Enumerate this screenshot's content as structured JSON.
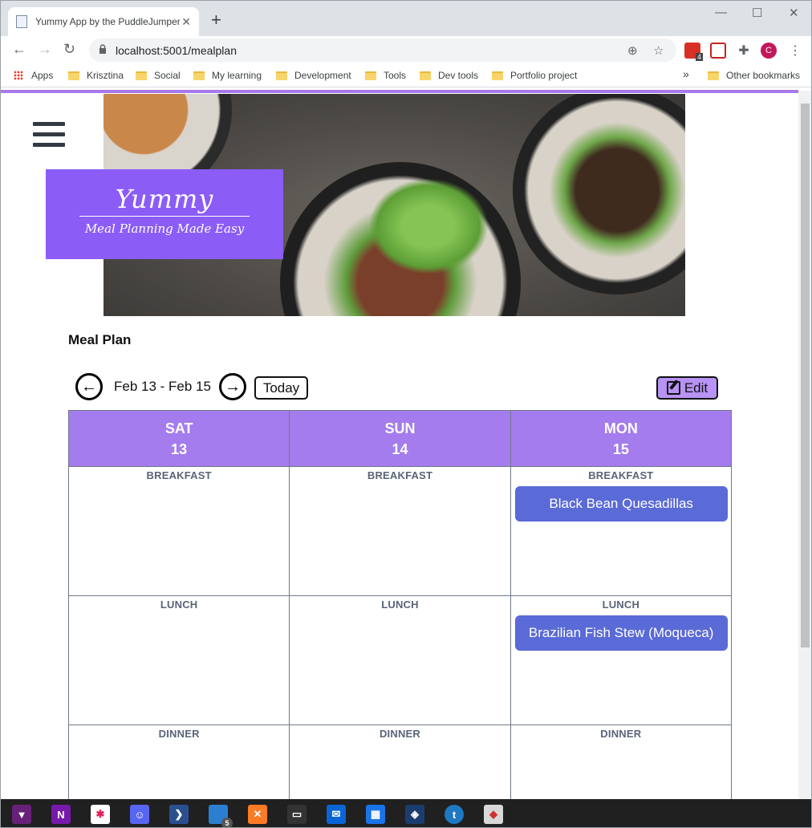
{
  "browser": {
    "tab_title": "Yummy App by the PuddleJumpers",
    "tab_close": "✕",
    "new_tab": "+",
    "url": "localhost:5001/mealplan",
    "profile_initial": "C",
    "extension_badge": "4"
  },
  "bookmarks": {
    "apps": "Apps",
    "items": [
      "Krisztina",
      "Social",
      "My learning",
      "Development",
      "Tools",
      "Dev tools",
      "Portfolio project"
    ],
    "overflow": "»",
    "other": "Other bookmarks"
  },
  "logo": {
    "title": "Yummy",
    "subtitle": "Meal Planning Made Easy"
  },
  "meal_plan": {
    "title": "Meal Plan",
    "date_range": "Feb 13 - Feb 15",
    "prev_symbol": "←",
    "next_symbol": "→",
    "today_label": "Today",
    "edit_label": "Edit",
    "days": [
      {
        "name": "SAT",
        "date": "13"
      },
      {
        "name": "SUN",
        "date": "14"
      },
      {
        "name": "MON",
        "date": "15"
      }
    ],
    "slots": [
      "BREAKFAST",
      "LUNCH",
      "DINNER"
    ],
    "meals": {
      "mon_breakfast": "Black Bean Quesadillas",
      "mon_lunch": "Brazilian Fish Stew (Moqueca)"
    }
  },
  "taskbar": {
    "vs_badge": "5"
  },
  "colors": {
    "accent_purple": "#8b5cf6",
    "header_purple": "#a47ced",
    "edit_button": "#b892f4",
    "meal_chip": "#5a6ad6"
  }
}
